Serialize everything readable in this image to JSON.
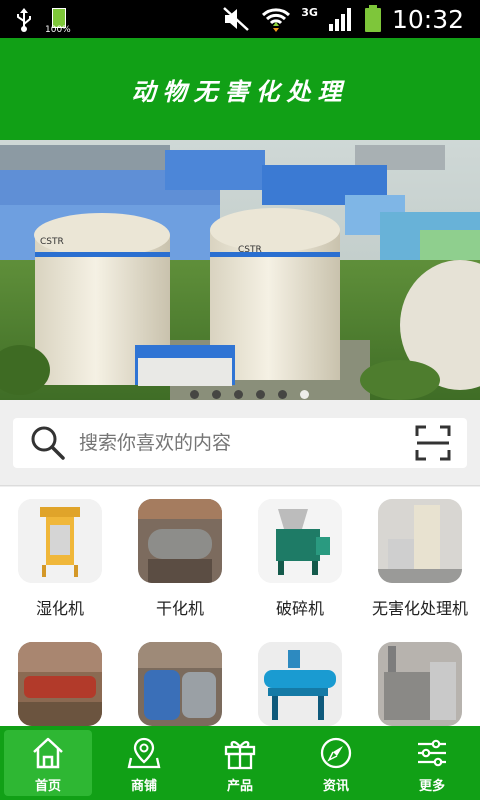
{
  "status": {
    "battery_pct": "100%",
    "network": "3G",
    "time": "10:32"
  },
  "header": {
    "title": "动物无害化处理"
  },
  "banner": {
    "sign_left": "CSTR",
    "sign_right": "CSTR",
    "slides": 6,
    "active_slide": 5
  },
  "search": {
    "placeholder": "搜索你喜欢的内容"
  },
  "categories": [
    {
      "label": "湿化机",
      "icon": "wet-rendering-machine"
    },
    {
      "label": "干化机",
      "icon": "dry-rendering-machine"
    },
    {
      "label": "破碎机",
      "icon": "crusher"
    },
    {
      "label": "无害化处理机",
      "icon": "harmless-treatment-machine"
    },
    {
      "label": "",
      "icon": "screw-conveyor"
    },
    {
      "label": "",
      "icon": "tank-machine"
    },
    {
      "label": "",
      "icon": "press-machine"
    },
    {
      "label": "",
      "icon": "incinerator"
    }
  ],
  "nav": [
    {
      "label": "首页",
      "icon": "home-icon",
      "active": true
    },
    {
      "label": "商铺",
      "icon": "shop-map-icon",
      "active": false
    },
    {
      "label": "产品",
      "icon": "gift-icon",
      "active": false
    },
    {
      "label": "资讯",
      "icon": "compass-icon",
      "active": false
    },
    {
      "label": "更多",
      "icon": "sliders-icon",
      "active": false
    }
  ],
  "colors": {
    "brand_green": "#11a016",
    "nav_active": "#2eb733",
    "status_bar": "#000000"
  }
}
